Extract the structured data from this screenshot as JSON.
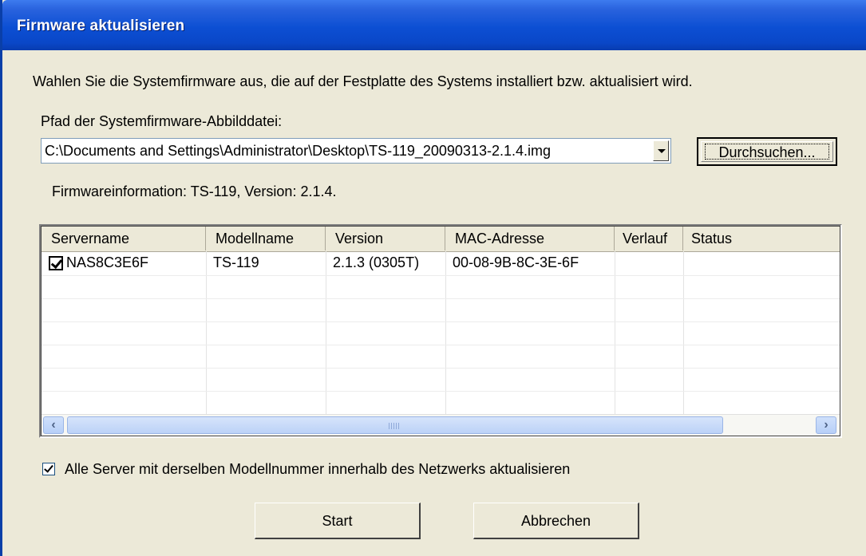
{
  "window": {
    "title": "Firmware aktualisieren"
  },
  "intro": "Wahlen Sie die Systemfirmware aus, die auf der Festplatte des Systems installiert bzw. aktualisiert wird.",
  "path": {
    "label": "Pfad der Systemfirmware-Abbilddatei:",
    "value": "C:\\Documents and Settings\\Administrator\\Desktop\\TS-119_20090313-2.1.4.img",
    "browse_label": "Durchsuchen..."
  },
  "firmware_info": "Firmwareinformation: TS-119, Version: 2.1.4.",
  "table": {
    "columns": [
      "Servername",
      "Modellname",
      "Version",
      "MAC-Adresse",
      "Verlauf",
      "Status"
    ],
    "rows": [
      {
        "checked": true,
        "servername": "NAS8C3E6F",
        "modellname": "TS-119",
        "version": "2.1.3 (0305T)",
        "mac": "00-08-9B-8C-3E-6F",
        "verlauf": "",
        "status": ""
      }
    ]
  },
  "options": {
    "update_all_label": "Alle Server mit derselben Modellnummer innerhalb des Netzwerks aktualisieren",
    "update_all_checked": true
  },
  "buttons": {
    "start": "Start",
    "cancel": "Abbrechen"
  },
  "icons": [
    "checkbox-checked-icon",
    "dropdown-arrow-icon",
    "scroll-left-icon",
    "scroll-right-icon"
  ],
  "colors": {
    "titlebar": "#0a47c8",
    "face": "#ece9d8"
  }
}
